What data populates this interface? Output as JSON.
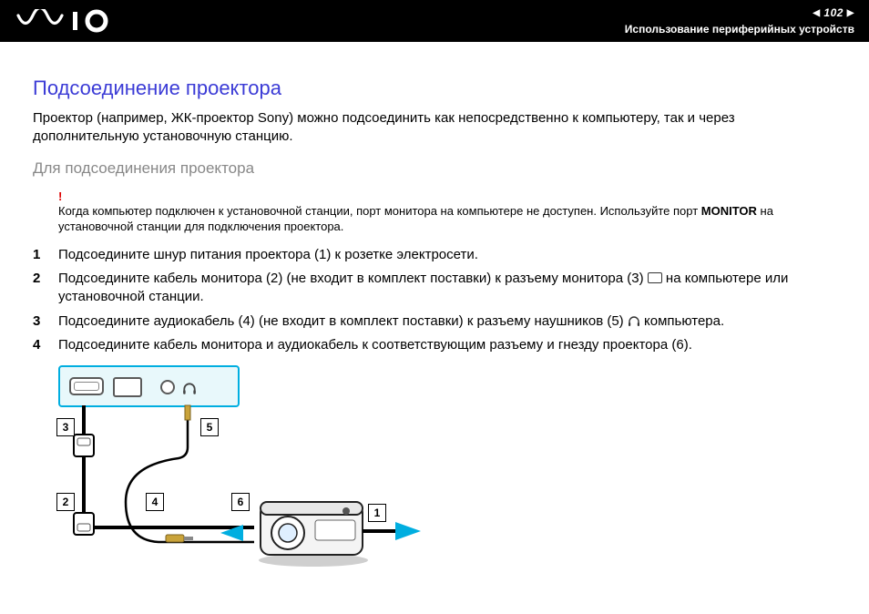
{
  "header": {
    "page_number": "102",
    "section": "Использование периферийных устройств"
  },
  "title": "Подсоединение проектора",
  "intro": "Проектор (например, ЖК-проектор Sony) можно подсоединить как непосредственно к компьютеру, так и через дополнительную установочную станцию.",
  "subtitle": "Для подсоединения проектора",
  "warning_mark": "!",
  "warning_a": "Когда компьютер подключен к установочной станции, порт монитора на компьютере не доступен. Используйте порт ",
  "warning_bold": "MONITOR",
  "warning_b": " на установочной станции для подключения проектора.",
  "steps": {
    "n1": "1",
    "t1": "Подсоедините шнур питания проектора (1) к розетке электросети.",
    "n2": "2",
    "t2a": "Подсоедините кабель монитора (2) (не входит в комплект поставки) к разъему монитора (3) ",
    "t2b": " на компьютере или установочной станции.",
    "n3": "3",
    "t3a": "Подсоедините аудиокабель (4) (не входит в комплект поставки) к разъему наушников (5) ",
    "t3b": " компьютера.",
    "n4": "4",
    "t4": "Подсоедините кабель монитора и аудиокабель к соответствующим разъему и гнезду проектора (6)."
  },
  "labels": {
    "l1": "1",
    "l2": "2",
    "l3": "3",
    "l4": "4",
    "l5": "5",
    "l6": "6"
  }
}
